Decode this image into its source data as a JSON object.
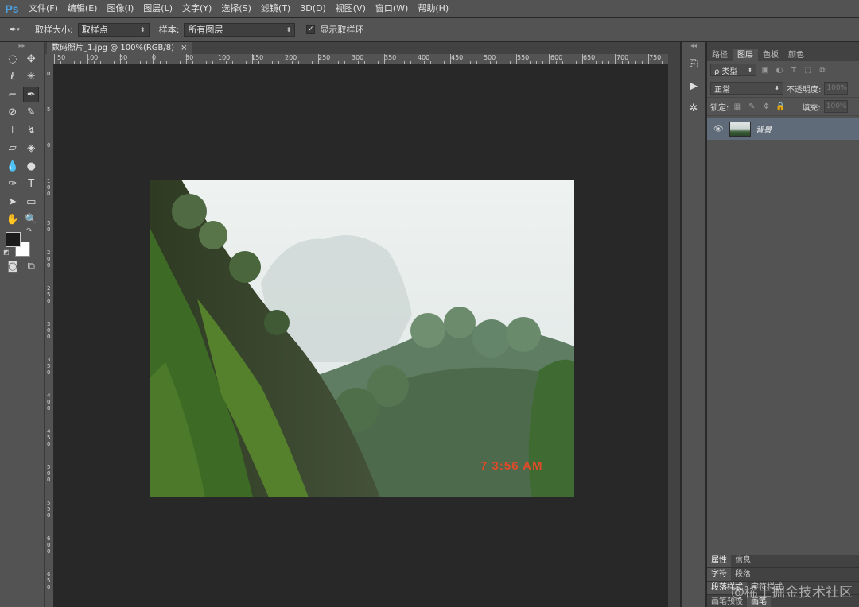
{
  "app": {
    "logo": "Ps"
  },
  "menu": [
    "文件(F)",
    "编辑(E)",
    "图像(I)",
    "图层(L)",
    "文字(Y)",
    "选择(S)",
    "滤镜(T)",
    "3D(D)",
    "视图(V)",
    "窗口(W)",
    "帮助(H)"
  ],
  "options": {
    "sample_size_label": "取样大小:",
    "sample_size_value": "取样点",
    "sample_label": "样本:",
    "sample_value": "所有图层",
    "show_ring_label": "显示取样环",
    "show_ring_checked": true
  },
  "document": {
    "tab_title": "数码照片_1.jpg @ 100%(RGB/8)",
    "close": "×"
  },
  "ruler_top_labels": [
    "50",
    "100",
    "50",
    "0",
    "50",
    "100",
    "150",
    "200",
    "250",
    "300",
    "350",
    "400",
    "450",
    "500",
    "550",
    "600",
    "650",
    "700",
    "750"
  ],
  "ruler_left_labels": [
    "0",
    "5",
    "0",
    "1 0 0",
    "1 5 0",
    "2 0 0",
    "2 5 0",
    "3 0 0",
    "3 5 0",
    "4 0 0",
    "4 5 0",
    "5 0 0",
    "5 5 0",
    "6 0 0",
    "6 5 0"
  ],
  "photo": {
    "timestamp": "7 3:56 AM"
  },
  "layers_panel": {
    "tabs": [
      "路径",
      "图层",
      "色板",
      "颜色"
    ],
    "active_tab": "图层",
    "filter_kind": "ρ 类型",
    "blend_mode": "正常",
    "opacity_label": "不透明度:",
    "opacity_value": "100%",
    "lock_label": "锁定:",
    "fill_label": "填充:",
    "fill_value": "100%",
    "layers": [
      {
        "name": "背景",
        "visible": true
      }
    ]
  },
  "lower_panels": {
    "row1": [
      "属性",
      "信息"
    ],
    "row2": [
      "字符",
      "段落"
    ],
    "row3": [
      "段落样式",
      "字符样式"
    ],
    "row4": [
      "画笔预设",
      "画笔"
    ]
  },
  "watermark": "@稀土掘金技术社区",
  "colors": {
    "foreground": "#1c1c1c",
    "background": "#ffffff",
    "timestamp": "#e04a2a",
    "accent": "#4ba3e3"
  }
}
